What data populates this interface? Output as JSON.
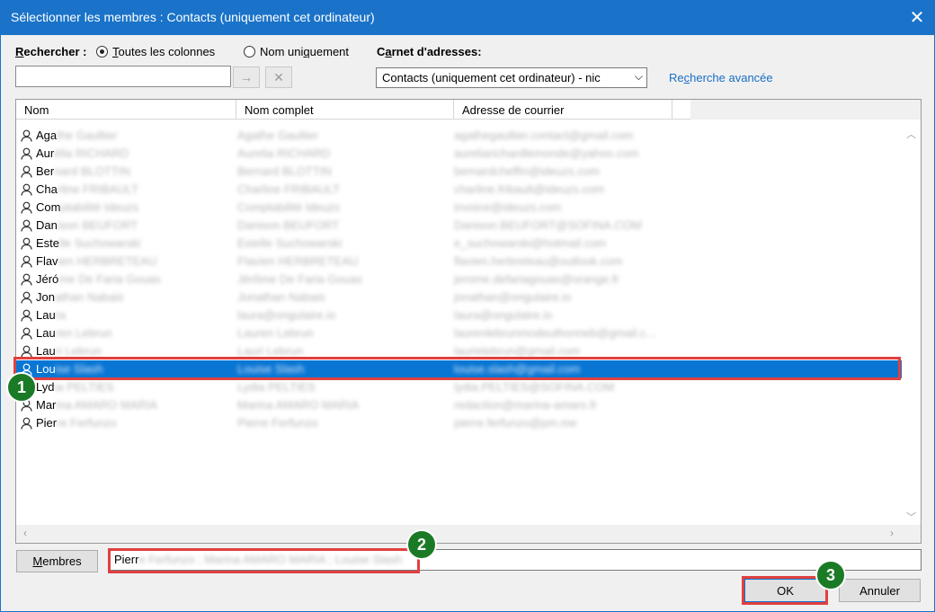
{
  "window": {
    "title": "Sélectionner les membres : Contacts (uniquement cet ordinateur)",
    "close_glyph": "✕"
  },
  "search": {
    "label": "Rechercher :",
    "label_mnemonic": "R",
    "label_rest": "echercher :",
    "value": "",
    "option_all_mnemonic": "T",
    "option_all_rest": "outes les colonnes",
    "option_name_pre": "Nom uni",
    "option_name_mnemonic": "q",
    "option_name_post": "uement",
    "selected_option": "Toutes les colonnes",
    "go_glyph": "→",
    "clear_glyph": "✕"
  },
  "address_book": {
    "label_pre": "C",
    "label_mnemonic": "a",
    "label_post": "rnet d'adresses:",
    "selected": "Contacts (uniquement cet ordinateur) - nic",
    "advanced_pre": "Re",
    "advanced_mnemonic": "c",
    "advanced_post": "herche avancée"
  },
  "table": {
    "columns": [
      "Nom",
      "Nom complet",
      "Adresse de courrier"
    ],
    "rows": [
      {
        "name_visible": "Aga",
        "name_blur": "the Gaultier",
        "full": "Agathe Gaultier",
        "email": "agathegaultier.contact@gmail.com"
      },
      {
        "name_visible": "Aur",
        "name_blur": "élia RICHARD",
        "full": "Aurelia RICHARD",
        "email": "aureliarichardlemonde@yahoo.com"
      },
      {
        "name_visible": "Ber",
        "name_blur": "nard BLOTTIN",
        "full": "Bernard BLOTTIN",
        "email": "bernardcheffin@ideuzs.com"
      },
      {
        "name_visible": "Cha",
        "name_blur": "rline FRIBAULT",
        "full": "Charline FRIBAULT",
        "email": "charline.fribault@ideuzs.com"
      },
      {
        "name_visible": "Com",
        "name_blur": "ptabilité Ideuzs",
        "full": "Comptabilité Ideuzs",
        "email": "invoice@ideuzs.com"
      },
      {
        "name_visible": "Dan",
        "name_blur": "ison BEUFORT",
        "full": "Danison BEUFORT",
        "email": "Danison.BEUFORT@SOFINA.COM"
      },
      {
        "name_visible": "Este",
        "name_blur": "lle Suchowarski",
        "full": "Estelle Suchowarski",
        "email": "e_suchowarski@hotmail.com"
      },
      {
        "name_visible": "Flav",
        "name_blur": "ien HERBRETEAU",
        "full": "Flavien HERBRETEAU",
        "email": "flavien.herbreteau@outlook.com"
      },
      {
        "name_visible": "Jéró",
        "name_blur": "me De Faria Gouas",
        "full": "Jérôme De Faria Gouas",
        "email": "jerome.defariagouas@orange.fr"
      },
      {
        "name_visible": "Jon",
        "name_blur": "athan Nabais",
        "full": "Jonathan Nabais",
        "email": "jonathan@ongulaire.io"
      },
      {
        "name_visible": "Lau",
        "name_blur": "ra",
        "full": "laura@ongulaire.io",
        "email": "laura@ongulaire.io"
      },
      {
        "name_visible": "Lau",
        "name_blur": "ren Lebrun",
        "full": "Lauren Lebrun",
        "email": "laurenlebrunmodeuthonneb@gmail.c..."
      },
      {
        "name_visible": "Lau",
        "name_blur": "ri Lebrun",
        "full": "Lauri Lebrun",
        "email": "laurielebrun@gmail.com"
      },
      {
        "name_visible": "Lou",
        "name_blur": "ise Slash",
        "full": "Louise Slash",
        "email": "louise.slash@gmail.com",
        "selected": true
      },
      {
        "name_visible": "Lyd",
        "name_blur": "ia PELTIES",
        "full": "Lydia PELTIES",
        "email": "lydia.PELTIES@SOFINA.COM"
      },
      {
        "name_visible": "Mar",
        "name_blur": "ina AMARO MARIA",
        "full": "Marina AMARO MARIA",
        "email": "redaction@marina-amaro.fr"
      },
      {
        "name_visible": "Pier",
        "name_blur": "re Ferfunzo",
        "full": "Pierre Ferfunzo",
        "email": "pierre.ferfunzo@pm.me"
      }
    ]
  },
  "members": {
    "button_pre": "",
    "button_mnemonic": "M",
    "button_post": "embres",
    "value_visible": "Pierr",
    "value_blur": "e Ferfunzo ; Marina AMARO MARIA ; Louise Slash"
  },
  "buttons": {
    "ok": "OK",
    "cancel": "Annuler"
  },
  "badges": [
    "1",
    "2",
    "3"
  ],
  "colors": {
    "titlebar": "#1a73c9",
    "selection": "#0a76d4",
    "highlight": "#e0403f",
    "badge": "#1b7a26",
    "link": "#1a6fc4"
  }
}
